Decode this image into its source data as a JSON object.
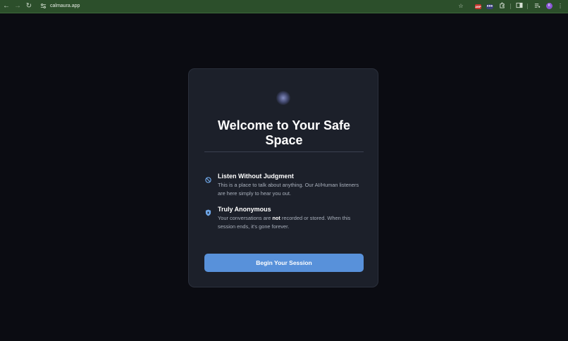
{
  "browser": {
    "url": "calmaura.app",
    "ext_label": "ABP",
    "ext_dots": "•••",
    "avatar_initial": "K"
  },
  "card": {
    "title": "Welcome to Your Safe Space",
    "features": [
      {
        "icon": "circle-slash-icon",
        "heading": "Listen Without Judgment",
        "text": "This is a place to talk about anything. Our AI/Human listeners are here simply to hear you out."
      },
      {
        "icon": "shield-icon",
        "heading": "Truly Anonymous",
        "text_before": "Your conversations are ",
        "text_bold": "not",
        "text_after": " recorded or stored. When this session ends, it's gone forever."
      }
    ],
    "button_label": "Begin Your Session"
  },
  "colors": {
    "accent": "#5891da",
    "card_bg": "#1c202a",
    "page_bg": "#0b0c12",
    "toolbar_bg": "#2c4f2b"
  }
}
